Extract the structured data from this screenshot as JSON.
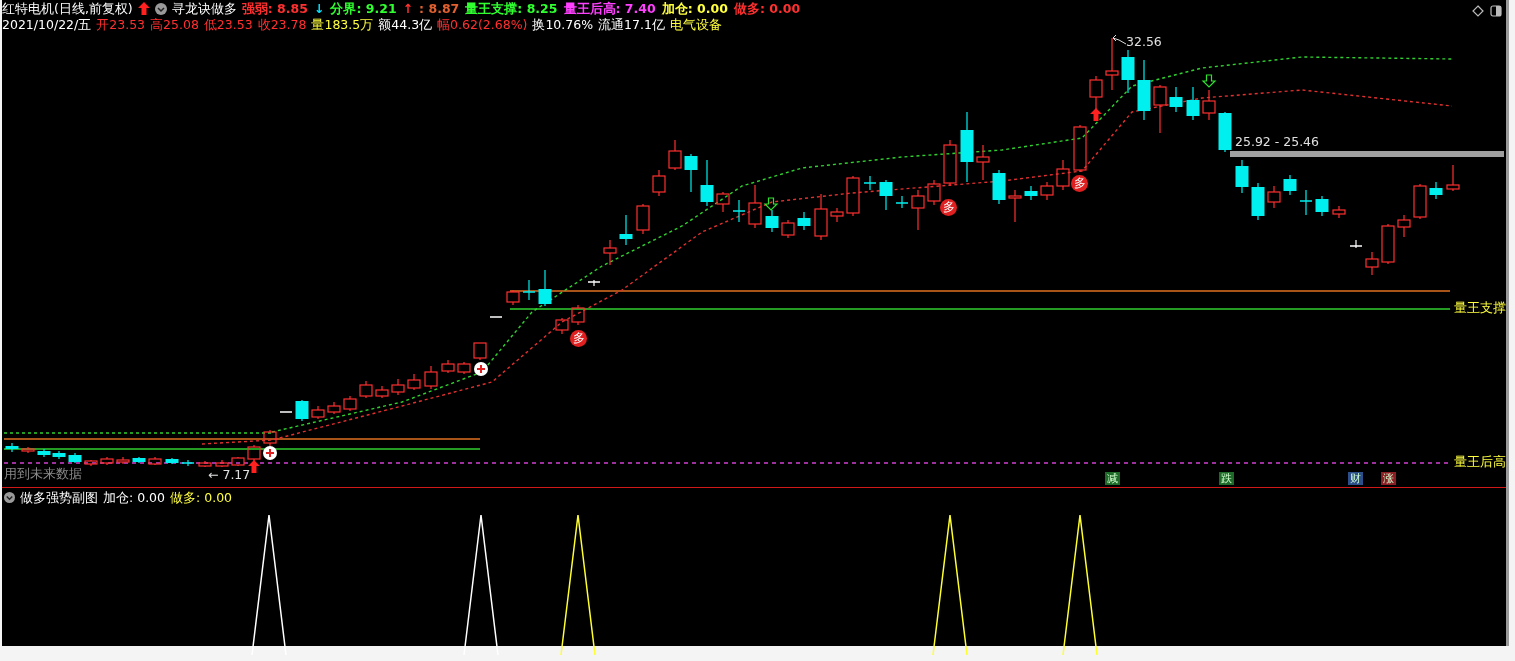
{
  "header": {
    "security": "红特电机(日线,前复权)",
    "indicator": "寻龙诀做多",
    "values": [
      {
        "text": "强弱: 8.85",
        "color": "#ff3030"
      },
      {
        "text": "↓",
        "color": "#00e0ff"
      },
      {
        "text": "分界: 9.21",
        "color": "#30ff30"
      },
      {
        "text": "↑",
        "color": "#ff3030"
      },
      {
        "text": ": 8.87",
        "color": "#e06030"
      },
      {
        "text": "量王支撑: 8.25",
        "color": "#30ff30"
      },
      {
        "text": "量王后高: 7.40",
        "color": "#ff40ff"
      },
      {
        "text": "加仓: 0.00",
        "color": "#ffff40"
      },
      {
        "text": "做多: 0.00",
        "color": "#ff3030"
      }
    ]
  },
  "quote": [
    {
      "text": "2021/10/22/五",
      "color": "#ffffff"
    },
    {
      "text": "开23.53",
      "color": "#ff3030"
    },
    {
      "text": "高25.08",
      "color": "#ff3030"
    },
    {
      "text": "低23.53",
      "color": "#ff3030"
    },
    {
      "text": "收23.78",
      "color": "#ff3030"
    },
    {
      "text": "量183.5万",
      "color": "#ffff40"
    },
    {
      "text": "额44.3亿",
      "color": "#ffffff"
    },
    {
      "text": "幅0.62(2.68%)",
      "color": "#ff3030"
    },
    {
      "text": "换10.76%",
      "color": "#ffffff"
    },
    {
      "text": "流通17.1亿",
      "color": "#ffffff"
    },
    {
      "text": "电气设备",
      "color": "#ffff40"
    }
  ],
  "chart_labels": [
    {
      "kind": "high",
      "text": "32.56"
    },
    {
      "kind": "range",
      "text": "25.92 - 25.46"
    },
    {
      "kind": "low",
      "text": "← 7.17"
    },
    {
      "kind": "warning",
      "text": "用到未来数据"
    }
  ],
  "line_labels": [
    {
      "text": "量王支撑"
    },
    {
      "text": "量王后高"
    }
  ],
  "signal_badges": [
    {
      "text": "多"
    },
    {
      "text": "多"
    },
    {
      "text": "多"
    }
  ],
  "bottom_markers": [
    {
      "text": "减",
      "color": "#1e6a28"
    },
    {
      "text": "跌",
      "color": "#1e6a28"
    },
    {
      "text": "财",
      "color": "#2c4f8a"
    },
    {
      "text": "涨",
      "color": "#8a1e24"
    }
  ],
  "subchart": {
    "title": "做多强势副图",
    "values": [
      {
        "text": "加仓: 0.00",
        "color": "#ffffff"
      },
      {
        "text": "做多: 0.00",
        "color": "#ffff40"
      }
    ]
  }
}
